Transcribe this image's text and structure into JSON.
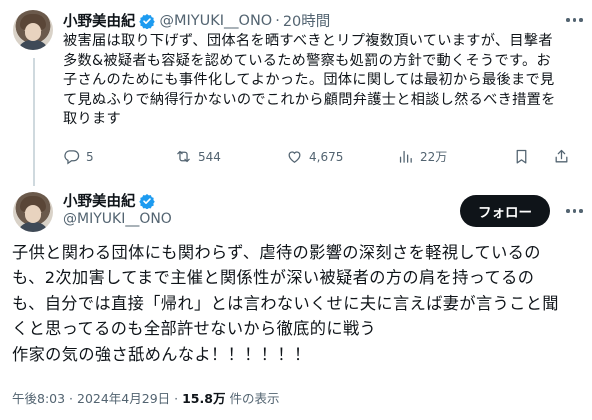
{
  "tweet1": {
    "author_name": "小野美由紀",
    "handle": "@MIYUKI__ONO",
    "separator": "·",
    "time": "20時間",
    "lines": [
      "被害届は取り下げず、団体名を晒すべきとリプ複数頂いていますが、目撃者",
      "多数&被疑者も容疑を認めているため警察も処罰の方針で動くそうです。お",
      "子さんのためにも事件化してよかった。団体に関しては最初から最後まで見",
      "て見ぬふりで納得行かないのでこれから顧問弁護士と相談し然るべき措置を",
      "取ります"
    ],
    "actions": {
      "replies": "5",
      "reposts": "544",
      "likes": "4,675",
      "views": "22万"
    }
  },
  "tweet2": {
    "author_name": "小野美由紀",
    "handle": "@MIYUKI__ONO",
    "follow_label": "フォロー",
    "lines": [
      "子供と関わる団体にも関わらず、虐待の影響の深刻さを軽視しているの",
      "も、2次加害してまで主催と関係性が深い被疑者の方の肩を持ってるの",
      "も、自分では直接「帰れ」とは言わないくせに夫に言えば妻が言うこと聞",
      "くと思ってるのも全部許せないから徹底的に戦う",
      "作家の気の強さ舐めんなよ！！！！！！"
    ],
    "meta": {
      "timestamp": "午後8:03 · 2024年4月29日 ·",
      "views_count": "15.8万",
      "views_label": "件の表示"
    }
  },
  "colors": {
    "verified": "#1d9bf0",
    "secondary_text": "#536471",
    "primary_text": "#0f1419",
    "follow_button": "#0f1419"
  }
}
